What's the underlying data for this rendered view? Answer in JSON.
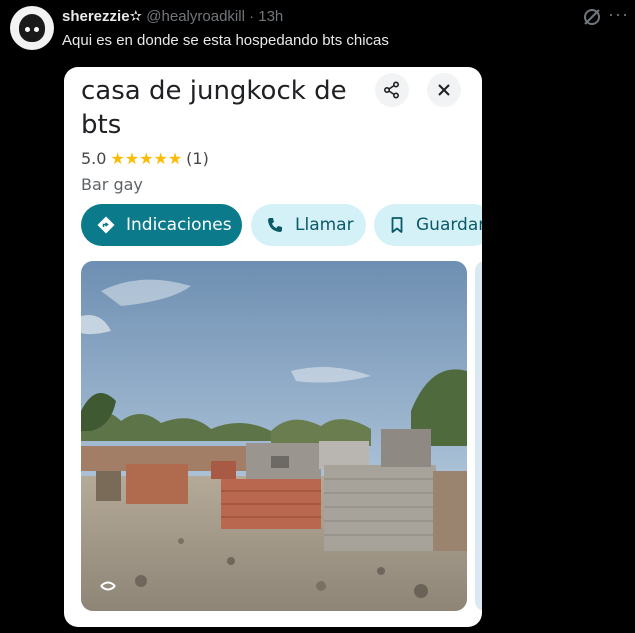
{
  "tweet": {
    "display_name": "sherezzie",
    "handle": "@healyroadkill",
    "separator": "·",
    "time": "13h",
    "text": "Aqui es en donde se esta hospedando bts chicas",
    "more_label": "···"
  },
  "place_card": {
    "title": "casa de jungkock de bts",
    "rating_value": "5.0",
    "stars": "★★★★★",
    "review_count": "(1)",
    "category": "Bar gay",
    "actions": [
      {
        "label": "Indicaciones",
        "icon": "directions-icon"
      },
      {
        "label": "Llamar",
        "icon": "phone-icon"
      },
      {
        "label": "Guardar",
        "icon": "bookmark-icon"
      }
    ]
  },
  "colors": {
    "background": "#000000",
    "primary_button": "#0b7b8b",
    "secondary_button": "#d5f1f8",
    "star": "#fbbc04"
  }
}
